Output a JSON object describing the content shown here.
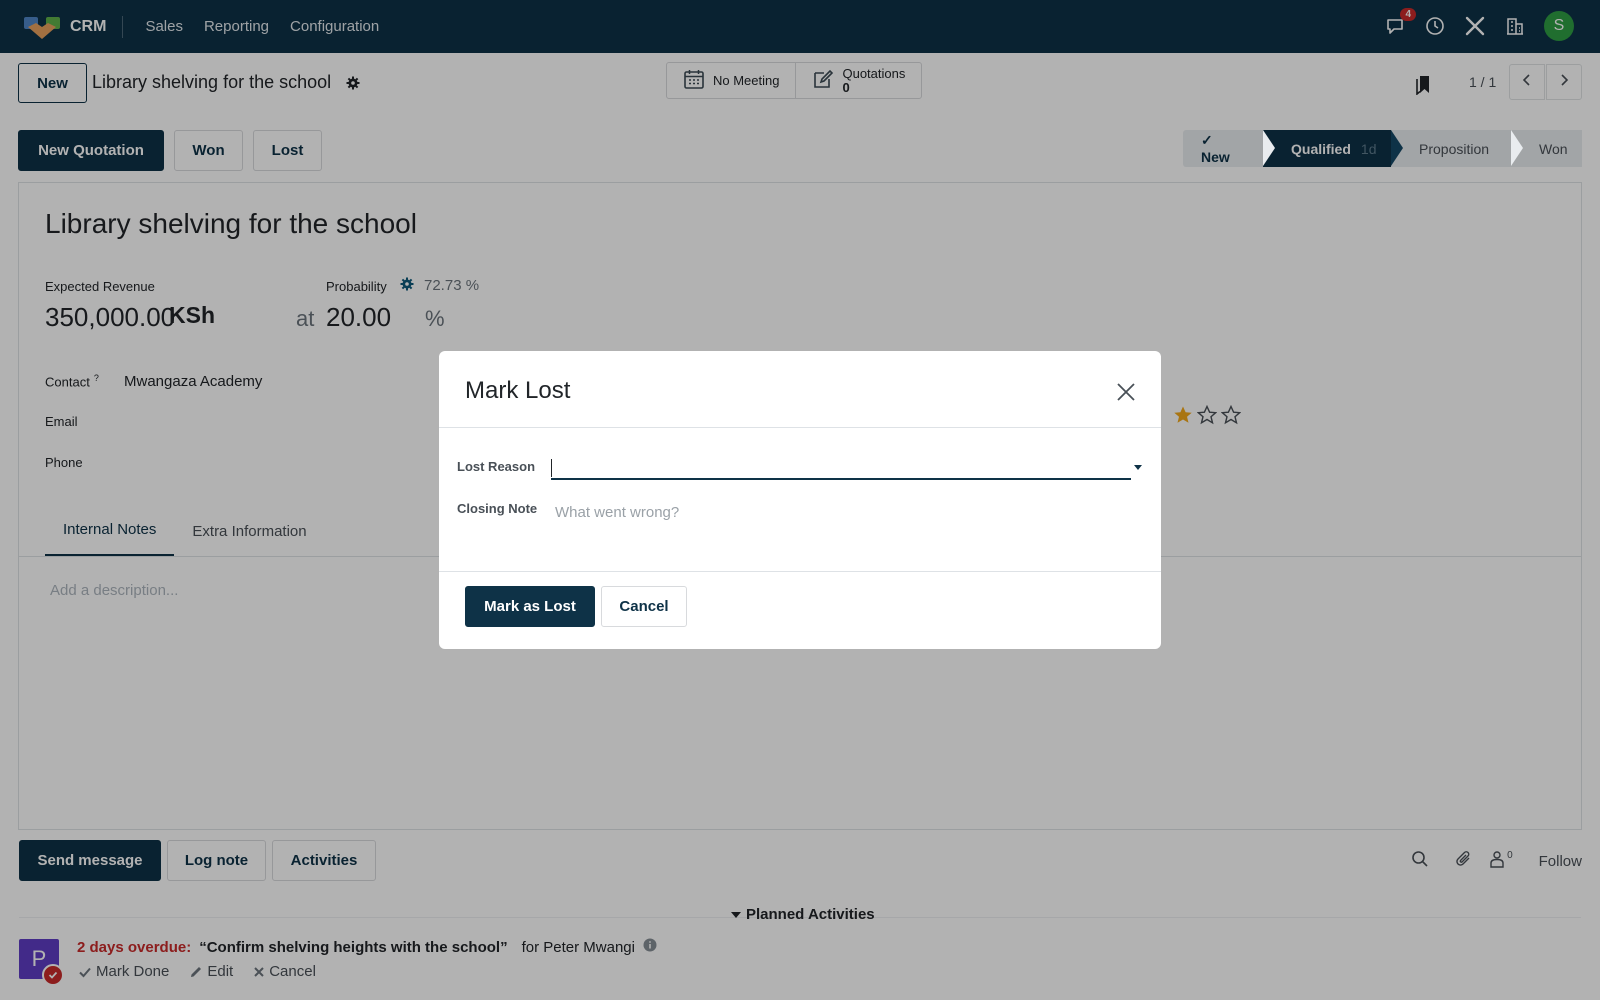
{
  "topbar": {
    "app_name": "CRM",
    "menu": [
      "Sales",
      "Reporting",
      "Configuration"
    ],
    "messages_badge": "4",
    "user_initial": "S",
    "colors": {
      "bar": "#0e3247",
      "avatar": "#2f9e44"
    }
  },
  "control": {
    "new_label": "New",
    "breadcrumb_title": "Library shelving for the school",
    "smart_buttons": {
      "meeting_label": "No Meeting",
      "quotations_label": "Quotations",
      "quotations_count": "0"
    },
    "pager": "1 / 1"
  },
  "statusbar": {
    "new_quotation": "New Quotation",
    "won": "Won",
    "lost": "Lost",
    "stages": {
      "s1": "✓  New",
      "s2": "Qualified",
      "s2_duration": "1d",
      "s3": "Proposition",
      "s4": "Won"
    }
  },
  "form": {
    "title": "Library shelving for the school",
    "expected_revenue_label": "Expected Revenue",
    "expected_revenue": "350,000.00",
    "currency": "KSh",
    "at": "at",
    "probability_label": "Probability",
    "automated_probability": "72.73 %",
    "probability": "20.00",
    "percent": "%",
    "contact_label": "Contact",
    "contact_help": "?",
    "contact_value": "Mwangaza Academy",
    "email_label": "Email",
    "phone_label": "Phone",
    "priority_stars": 1,
    "tabs": [
      "Internal Notes",
      "Extra Information"
    ],
    "description_placeholder": "Add a description..."
  },
  "chatter": {
    "send_message": "Send message",
    "log_note": "Log note",
    "activities": "Activities",
    "followers_count": "0",
    "follow": "Follow",
    "planned_title": "Planned Activities",
    "activity": {
      "avatar_initial": "P",
      "overdue": "2 days overdue:",
      "summary": "“Confirm shelving heights with the school”",
      "assignee": "for Peter Mwangi",
      "mark_done": "Mark Done",
      "edit": "Edit",
      "cancel": "Cancel"
    }
  },
  "modal": {
    "title": "Mark Lost",
    "lost_reason_label": "Lost Reason",
    "lost_reason_value": "",
    "closing_note_label": "Closing Note",
    "closing_note_placeholder": "What went wrong?",
    "mark_as_lost": "Mark as Lost",
    "cancel": "Cancel"
  }
}
